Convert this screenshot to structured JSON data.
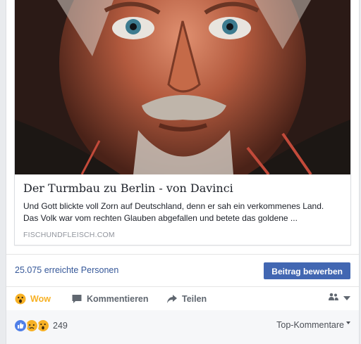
{
  "link": {
    "title": "Der Turmbau zu Berlin - von Davinci",
    "description_lines": [
      "Und Gott blickte voll Zorn auf Deutschland, denn er sah ein verkommenes Land.",
      "Das Volk war vom rechten Glauben abgefallen und betete das goldene ..."
    ],
    "domain": "FISCHUNDFLEISCH.COM",
    "image_icon": "portrait-image"
  },
  "reach": {
    "text": "25.075 erreichte Personen",
    "promote_label": "Beitrag bewerben"
  },
  "actions": {
    "wow_label": "Wow",
    "comment_label": "Kommentieren",
    "share_label": "Teilen",
    "audience_icon": "friends-icon"
  },
  "footer": {
    "reaction_count": "249",
    "reaction_icons": [
      "like-icon",
      "sad-icon",
      "wow-icon"
    ],
    "sort_label": "Top-Kommentare"
  },
  "colors": {
    "link": "#365899",
    "button": "#4267b2",
    "wow": "#f7b125"
  }
}
